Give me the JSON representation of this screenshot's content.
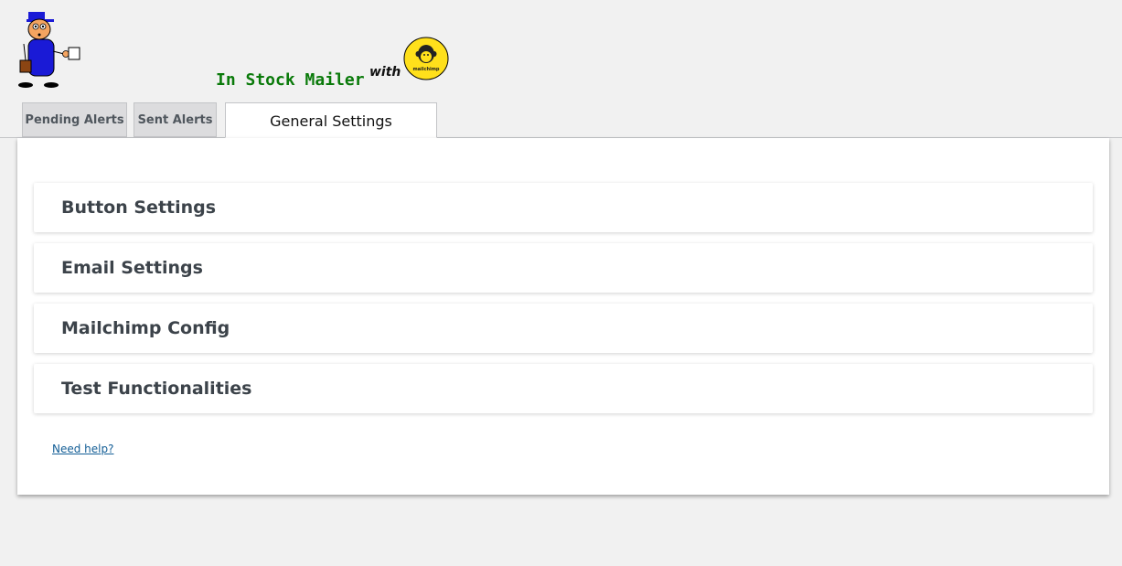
{
  "header": {
    "app_title": "In Stock Mailer",
    "with_label": "with",
    "mascot_icon": "mailman-mascot-icon",
    "partner_logo_icon": "mailchimp-logo-icon",
    "partner_logo_text": "mailchimp",
    "title_color": "#0a7a0a",
    "logo_color": "#ffe01b"
  },
  "tabs": [
    {
      "label": "Pending Alerts",
      "active": false
    },
    {
      "label": "Sent Alerts",
      "active": false
    },
    {
      "label": "General Settings",
      "active": true
    }
  ],
  "sections": [
    {
      "label": "Button Settings"
    },
    {
      "label": "Email Settings"
    },
    {
      "label": "Mailchimp Config"
    },
    {
      "label": "Test Functionalities"
    }
  ],
  "help_link": "Need help?",
  "colors": {
    "background": "#f1f1f1",
    "panel": "#ffffff",
    "link": "#135e96",
    "section_text": "#3c434a"
  }
}
